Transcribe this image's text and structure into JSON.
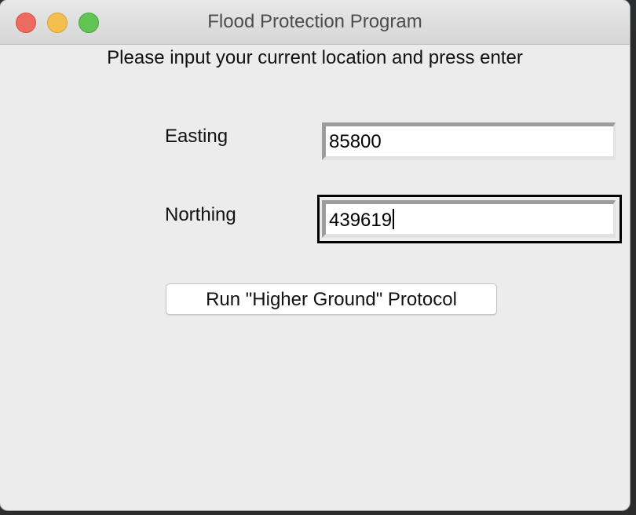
{
  "window": {
    "title": "Flood Protection Program",
    "controls": [
      "close",
      "minimize",
      "maximize"
    ]
  },
  "form": {
    "prompt": "Please input your current location and press enter",
    "easting": {
      "label": "Easting",
      "value": "85800"
    },
    "northing": {
      "label": "Northing",
      "value": "439619"
    },
    "run_button_label": "Run \"Higher Ground\" Protocol"
  },
  "colors": {
    "close": "#ed6a5e",
    "minimize": "#f5bf4f",
    "maximize": "#61c454",
    "window_bg": "#ececec"
  }
}
